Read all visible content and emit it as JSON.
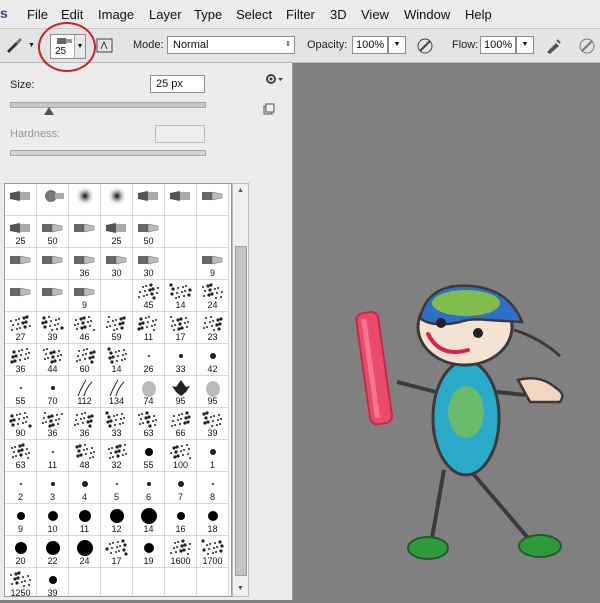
{
  "menubar": {
    "app_letter": "s",
    "items": [
      "File",
      "Edit",
      "Image",
      "Layer",
      "Type",
      "Select",
      "Filter",
      "3D",
      "View",
      "Window",
      "Help"
    ]
  },
  "options_bar": {
    "brush_size": "25",
    "mode_label": "Mode:",
    "mode_value": "Normal",
    "opacity_label": "Opacity:",
    "opacity_value": "100%",
    "flow_label": "Flow:",
    "flow_value": "100%"
  },
  "brush_panel": {
    "size_label": "Size:",
    "size_value": "25 px",
    "size_slider_fraction": 0.2,
    "hardness_label": "Hardness:",
    "hardness_value": ""
  },
  "presets": [
    [
      "",
      "",
      "",
      "",
      "",
      "",
      ""
    ],
    [
      "25",
      "50",
      "",
      "25",
      "50",
      "",
      ""
    ],
    [
      "",
      "",
      "36",
      "30",
      "30",
      "",
      "9"
    ],
    [
      "",
      "",
      "9",
      "",
      "45",
      "14",
      "24"
    ],
    [
      "27",
      "39",
      "46",
      "59",
      "11",
      "17",
      "23"
    ],
    [
      "36",
      "44",
      "60",
      "14",
      "26",
      "33",
      "42"
    ],
    [
      "55",
      "70",
      "112",
      "134",
      "74",
      "95",
      "95"
    ],
    [
      "90",
      "36",
      "36",
      "33",
      "63",
      "66",
      "39"
    ],
    [
      "63",
      "11",
      "48",
      "32",
      "55",
      "100",
      "1"
    ],
    [
      "2",
      "3",
      "4",
      "5",
      "6",
      "7",
      "8"
    ],
    [
      "9",
      "10",
      "11",
      "12",
      "14",
      "16",
      "18"
    ],
    [
      "20",
      "22",
      "24",
      "17",
      "19",
      "1600",
      "1700"
    ],
    [
      "1250",
      "39",
      "",
      "",
      "",
      "",
      ""
    ]
  ],
  "preset_icons": [
    [
      "flat",
      "fan",
      "soft",
      "soft",
      "flat",
      "flat",
      "round"
    ],
    [
      "flat",
      "round",
      "round",
      "flat",
      "round",
      "",
      ""
    ],
    [
      "round",
      "round",
      "round",
      "round",
      "round",
      "",
      "round"
    ],
    [
      "round",
      "round",
      "round",
      "",
      "scatter",
      "scatter",
      "scatter"
    ],
    [
      "scatter",
      "scatter",
      "scatter",
      "scatter",
      "scatter",
      "scatter",
      "scatter"
    ],
    [
      "scatter",
      "scatter",
      "scatter",
      "scatter",
      "dot",
      "dot",
      "dot"
    ],
    [
      "dot",
      "dot",
      "grass",
      "grass",
      "leaf",
      "leaf",
      "leaf"
    ],
    [
      "scatter",
      "scatter",
      "scatter",
      "scatter",
      "scatter",
      "scatter",
      "scatter"
    ],
    [
      "scatter",
      "dot",
      "scatter",
      "scatter",
      "hard",
      "scatter",
      "dot"
    ],
    [
      "dot",
      "dot",
      "dot",
      "dot",
      "dot",
      "dot",
      "dot"
    ],
    [
      "hard",
      "hard",
      "hard",
      "hard",
      "hard",
      "hard",
      "hard"
    ],
    [
      "hard",
      "hard",
      "hard",
      "scatter",
      "hard",
      "scatter",
      "scatter"
    ],
    [
      "scatter",
      "hard",
      "",
      "",
      "",
      "",
      ""
    ]
  ]
}
